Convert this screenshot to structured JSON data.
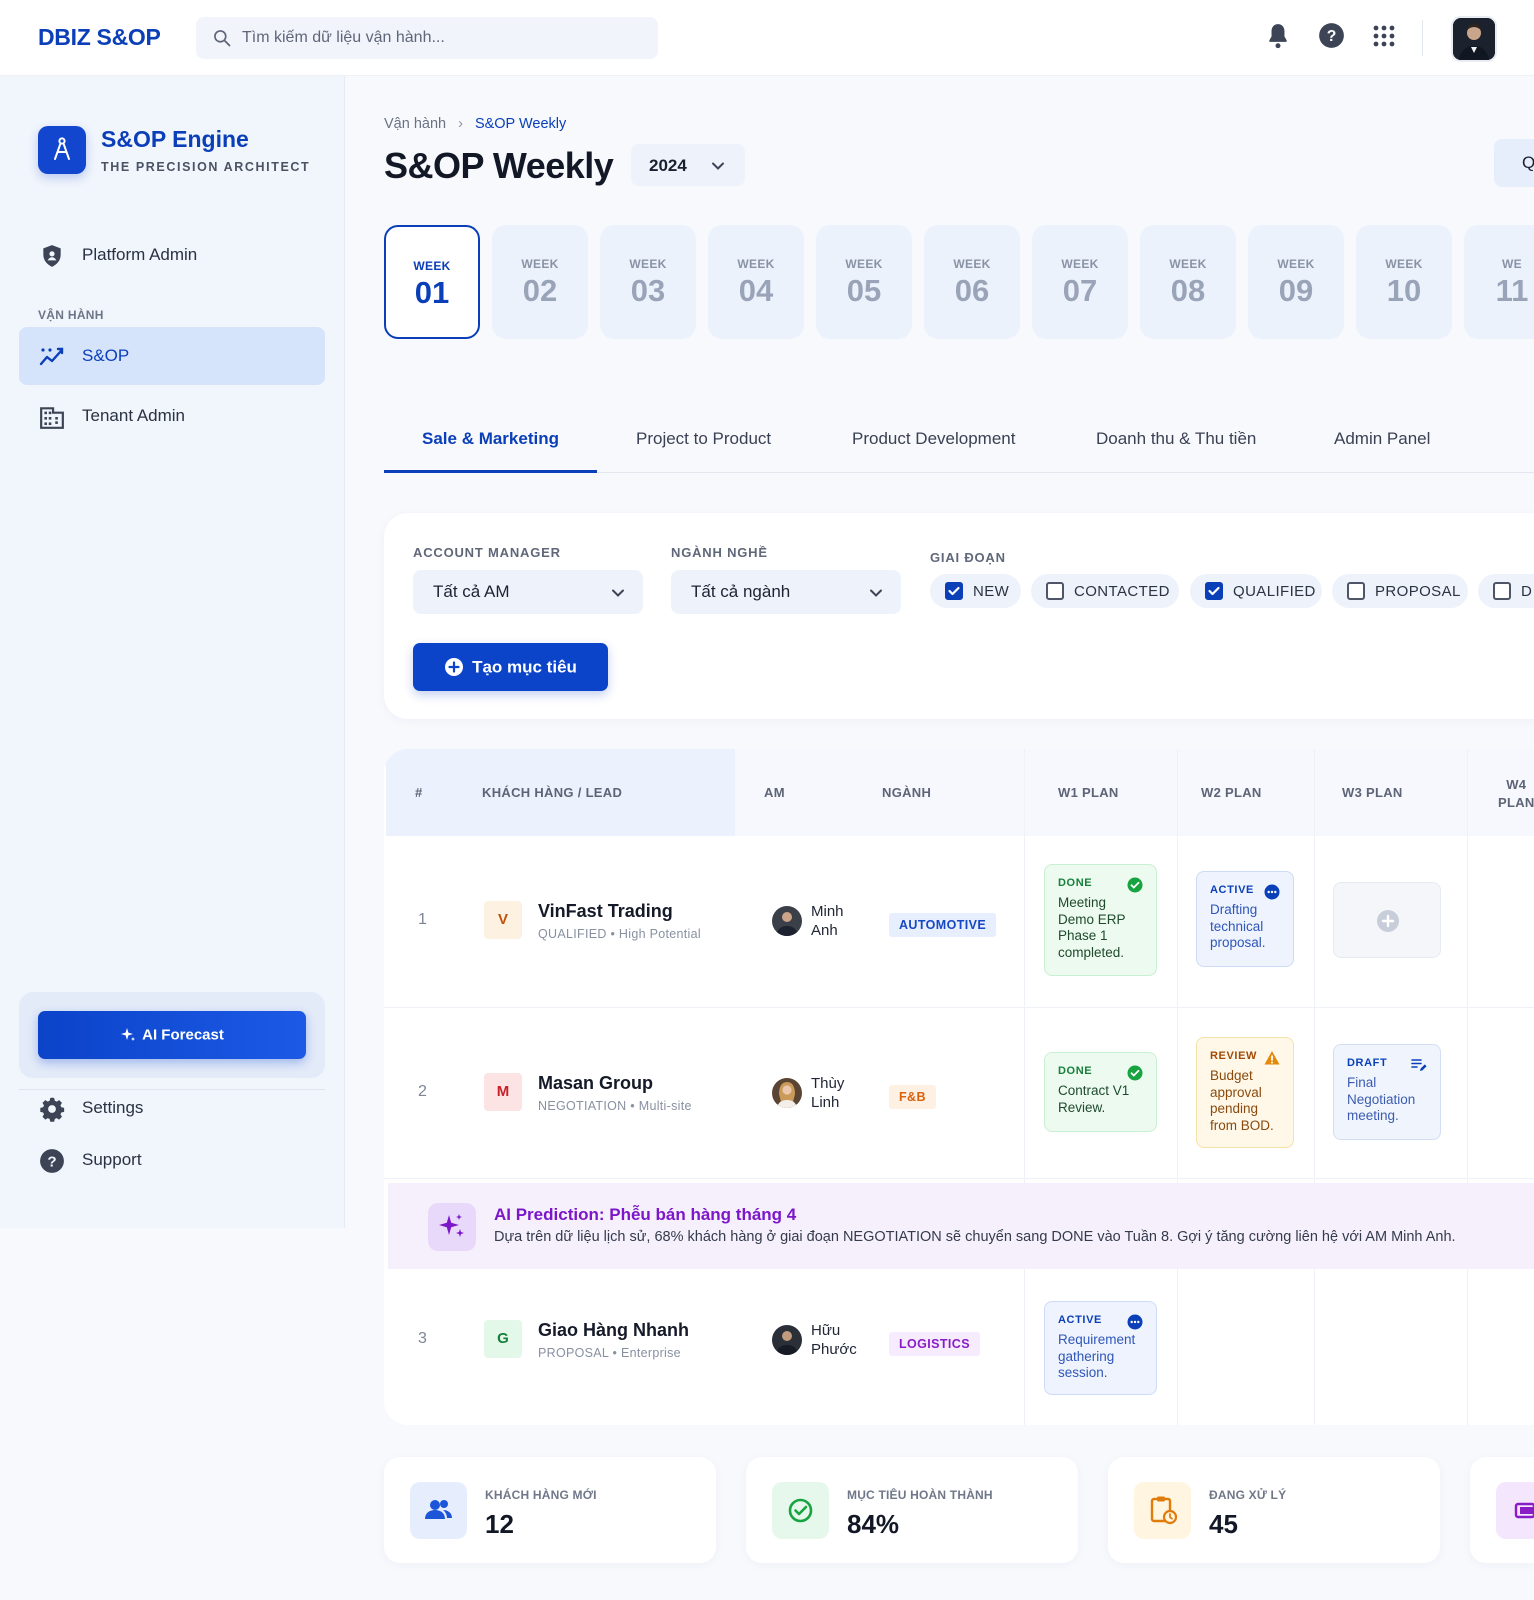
{
  "app": {
    "brand": "DBIZ S&OP"
  },
  "search": {
    "placeholder": "Tìm kiếm dữ liệu vận hành..."
  },
  "sidebar": {
    "engine_title": "S&OP Engine",
    "engine_subtitle": "THE PRECISION ARCHITECT",
    "section_label": "VẬN HÀNH",
    "items": [
      {
        "label": "Platform Admin",
        "icon": "shield-icon"
      },
      {
        "label": "S&OP",
        "icon": "trend-icon",
        "active": true
      },
      {
        "label": "Tenant Admin",
        "icon": "building-icon"
      }
    ],
    "ai_forecast_label": "AI Forecast",
    "footer": [
      {
        "label": "Settings",
        "icon": "gear-icon"
      },
      {
        "label": "Support",
        "icon": "help-icon"
      }
    ]
  },
  "breadcrumb": {
    "parent": "Vận hành",
    "current": "S&OP Weekly"
  },
  "page": {
    "title": "S&OP Weekly",
    "year": "2024",
    "right_button_partial": "Q"
  },
  "weeks": {
    "label": "WEEK",
    "items": [
      "01",
      "02",
      "03",
      "04",
      "05",
      "06",
      "07",
      "08",
      "09",
      "10",
      "11"
    ],
    "active": "01",
    "partial_label": "WE"
  },
  "tabs": [
    "Sale & Marketing",
    "Project to Product",
    "Product Development",
    "Doanh thu & Thu tiền",
    "Admin Panel"
  ],
  "filters": {
    "am_label": "ACCOUNT MANAGER",
    "am_value": "Tất cả AM",
    "industry_label": "NGÀNH NGHỀ",
    "industry_value": "Tất cả ngành",
    "stage_label": "GIAI ĐOẠN",
    "stages": [
      {
        "label": "NEW",
        "checked": true
      },
      {
        "label": "CONTACTED",
        "checked": false
      },
      {
        "label": "QUALIFIED",
        "checked": true
      },
      {
        "label": "PROPOSAL",
        "checked": false
      },
      {
        "label": "D",
        "checked": false
      }
    ],
    "create_button": "Tạo mục tiêu"
  },
  "table": {
    "headers": {
      "num": "#",
      "customer": "KHÁCH HÀNG / LEAD",
      "am": "AM",
      "industry": "NGÀNH",
      "w1": "W1 PLAN",
      "w2": "W2 PLAN",
      "w3": "W3 PLAN",
      "w4_line1": "W4",
      "w4_line2": "PLAN"
    },
    "rows": [
      {
        "num": "1",
        "initial": "V",
        "name": "VinFast Trading",
        "stage": "QUALIFIED",
        "note": "High Potential",
        "am_line1": "Minh",
        "am_line2": "Anh",
        "industry": "AUTOMOTIVE",
        "w1": {
          "status": "DONE",
          "text": "Meeting Demo ERP Phase 1 completed."
        },
        "w2": {
          "status": "ACTIVE",
          "text": "Drafting technical proposal."
        }
      },
      {
        "num": "2",
        "initial": "M",
        "name": "Masan Group",
        "stage": "NEGOTIATION",
        "note": "Multi-site",
        "am_line1": "Thùy",
        "am_line2": "Linh",
        "industry": "F&B",
        "w1": {
          "status": "DONE",
          "text": "Contract V1 Review."
        },
        "w2": {
          "status": "REVIEW",
          "text": "Budget approval pending from BOD."
        },
        "w3": {
          "status": "DRAFT",
          "text": "Final Negotiation meeting."
        }
      },
      {
        "num": "3",
        "initial": "G",
        "name": "Giao Hàng Nhanh",
        "stage": "PROPOSAL",
        "note": "Enterprise",
        "am_line1": "Hữu",
        "am_line2": "Phước",
        "industry": "LOGISTICS",
        "w1": {
          "status": "ACTIVE",
          "text": "Requirement gathering session."
        }
      }
    ],
    "ai_prediction": {
      "title": "AI Prediction: Phễu bán hàng tháng 4",
      "text": "Dựa trên dữ liệu lịch sử, 68% khách hàng ở giai đoạn NEGOTIATION sẽ chuyển sang DONE vào Tuần 8. Gợi ý tăng cường liên hệ với AM Minh Anh."
    }
  },
  "stats": [
    {
      "label": "KHÁCH HÀNG MỚI",
      "value": "12",
      "icon": "users-icon"
    },
    {
      "label": "MỤC TIÊU HOÀN THÀNH",
      "value": "84%",
      "icon": "check-circle-icon"
    },
    {
      "label": "ĐANG XỬ LÝ",
      "value": "45",
      "icon": "clipboard-clock-icon"
    }
  ],
  "colors": {
    "primary": "#0b3fb8",
    "ai_purple": "#7b16c9",
    "done_green": "#17803a",
    "review_orange": "#a24a05"
  }
}
